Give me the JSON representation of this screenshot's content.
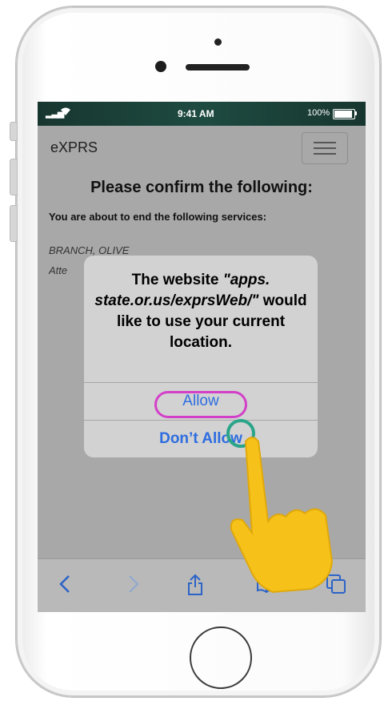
{
  "status_bar": {
    "time": "9:41 AM",
    "battery_text": "100%",
    "battery_level": 1.0
  },
  "header": {
    "brand": "eXPRS"
  },
  "page": {
    "title": "Please confirm the following:",
    "subtitle": "You are about to end the following services:",
    "name": "BRANCH, OLIVE",
    "attention_partial": "Atte"
  },
  "dialog": {
    "msg_before": "The website ",
    "msg_url": "\"apps. state.or.us/exprsWeb/\"",
    "msg_after": " would like to use your current location.",
    "allow_label": "Allow",
    "dont_allow_label": "Don’t Allow"
  },
  "toolbar": {
    "icons": [
      "back-icon",
      "forward-icon",
      "share-icon",
      "bookmarks-icon",
      "tabs-icon"
    ]
  },
  "colors": {
    "link_blue": "#2d6de0",
    "highlight_ring": "#d340c8",
    "tap_circle": "#2aa58a",
    "hand": "#f6c21a"
  }
}
